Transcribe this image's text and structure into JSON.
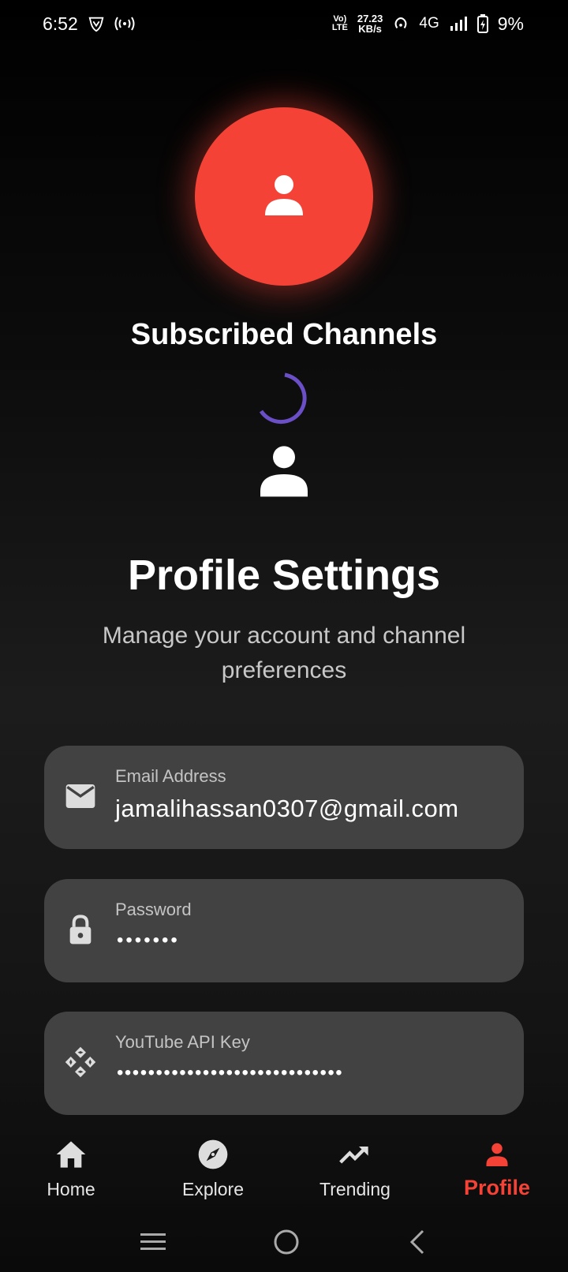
{
  "status_bar": {
    "time": "6:52",
    "volte_top": "Vo)",
    "volte_bottom": "LTE",
    "speed_value": "27.23",
    "speed_unit": "KB/s",
    "network": "4G",
    "battery": "9%"
  },
  "profile": {
    "subscribed_title": "Subscribed Channels",
    "settings_title": "Profile Settings",
    "settings_subtitle": "Manage your account and channel preferences"
  },
  "fields": {
    "email": {
      "label": "Email Address",
      "value": "jamalihassan0307@gmail.com"
    },
    "password": {
      "label": "Password",
      "value": "•••••••"
    },
    "api_key": {
      "label": "YouTube API Key",
      "value": "•••••••••••••••••••••••••••••"
    }
  },
  "bottom_nav": {
    "home": "Home",
    "explore": "Explore",
    "trending": "Trending",
    "profile": "Profile",
    "active": "profile"
  },
  "colors": {
    "accent": "#f44336",
    "spinner": "#6a4fc7",
    "field_bg": "#424242"
  }
}
